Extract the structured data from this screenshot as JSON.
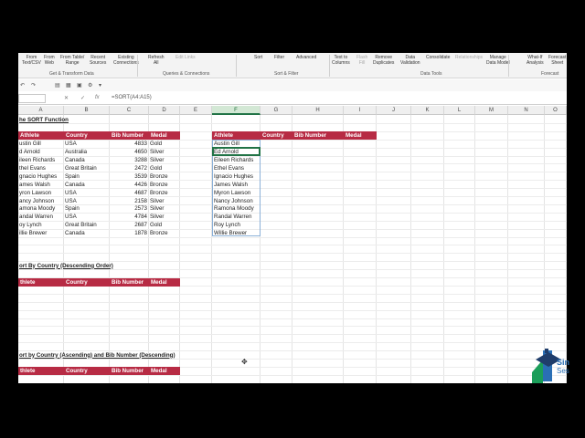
{
  "ribbon": {
    "items": [
      {
        "label": "From\nText/CSV",
        "dim": false
      },
      {
        "label": "From\nWeb",
        "dim": false
      },
      {
        "label": "From Table/\nRange",
        "dim": false
      },
      {
        "label": "Recent\nSources",
        "dim": false
      },
      {
        "label": "Existing\nConnections",
        "dim": false
      },
      {
        "label": "Refresh\nAll",
        "dim": false
      },
      {
        "label": "Edit Links",
        "dim": true
      },
      {
        "label": "Sort",
        "dim": false
      },
      {
        "label": "Filter",
        "dim": false
      },
      {
        "label": "Advanced",
        "dim": false
      },
      {
        "label": "Text to\nColumns",
        "dim": false
      },
      {
        "label": "Flash\nFill",
        "dim": true
      },
      {
        "label": "Remove\nDuplicates",
        "dim": false
      },
      {
        "label": "Data\nValidation",
        "dim": false
      },
      {
        "label": "Consolidate",
        "dim": false
      },
      {
        "label": "Relationships",
        "dim": true
      },
      {
        "label": "Manage\nData Model",
        "dim": false
      },
      {
        "label": "What-If\nAnalysis",
        "dim": false
      },
      {
        "label": "Forecast\nSheet",
        "dim": false
      }
    ],
    "groups": [
      "Get & Transform Data",
      "Queries & Connections",
      "Sort & Filter",
      "Data Tools",
      "Forecast"
    ]
  },
  "formula_bar": {
    "cancel": "✕",
    "enter": "✓",
    "fx": "fx",
    "formula": "=SORT(A4:A15)"
  },
  "columns": [
    "A",
    "B",
    "C",
    "D",
    "E",
    "F",
    "G",
    "H",
    "I",
    "J",
    "K",
    "L",
    "M",
    "N",
    "O"
  ],
  "title1": "he SORT Function",
  "header": [
    "Athlete",
    "Country",
    "Bib Number",
    "Medal"
  ],
  "rows": [
    [
      "ustin Gill",
      "USA",
      "4833",
      "Gold"
    ],
    [
      "d Arnold",
      "Australia",
      "4650",
      "Silver"
    ],
    [
      "ileen Richards",
      "Canada",
      "3288",
      "Silver"
    ],
    [
      "thel Evans",
      "Great Britain",
      "2472",
      "Gold"
    ],
    [
      "gnacio Hughes",
      "Spain",
      "3539",
      "Bronze"
    ],
    [
      "ames Walsh",
      "Canada",
      "4426",
      "Bronze"
    ],
    [
      "yron Lawson",
      "USA",
      "4687",
      "Bronze"
    ],
    [
      "ancy Johnson",
      "USA",
      "2158",
      "Silver"
    ],
    [
      "amona Moody",
      "Spain",
      "2573",
      "Silver"
    ],
    [
      "andal Warren",
      "USA",
      "4784",
      "Silver"
    ],
    [
      "oy Lynch",
      "Great Britain",
      "2687",
      "Gold"
    ],
    [
      "illie Brewer",
      "Canada",
      "1878",
      "Bronze"
    ]
  ],
  "header_cut": [
    "thlete",
    "Country",
    "Bib Number",
    "Medal"
  ],
  "sorted": {
    "header": [
      "Athlete",
      "Country",
      "Bib Number",
      "Medal"
    ],
    "names": [
      "Austin Gill",
      "Ed Arnold",
      "Eileen Richards",
      "Ethel Evans",
      "Ignacio Hughes",
      "James Walsh",
      "Myron Lawson",
      "Nancy Johnson",
      "Ramona Moody",
      "Randal Warren",
      "Roy Lynch",
      "Willie Brewer"
    ]
  },
  "title2": "ort By Country (Descending Order)",
  "title3": "ort by Country (Ascending) and Bib Number (Descending)",
  "colors": {
    "header_fill": "#b72b44",
    "accent": "#217346"
  },
  "logo": {
    "line1": "Sin",
    "line2": "Ses"
  }
}
